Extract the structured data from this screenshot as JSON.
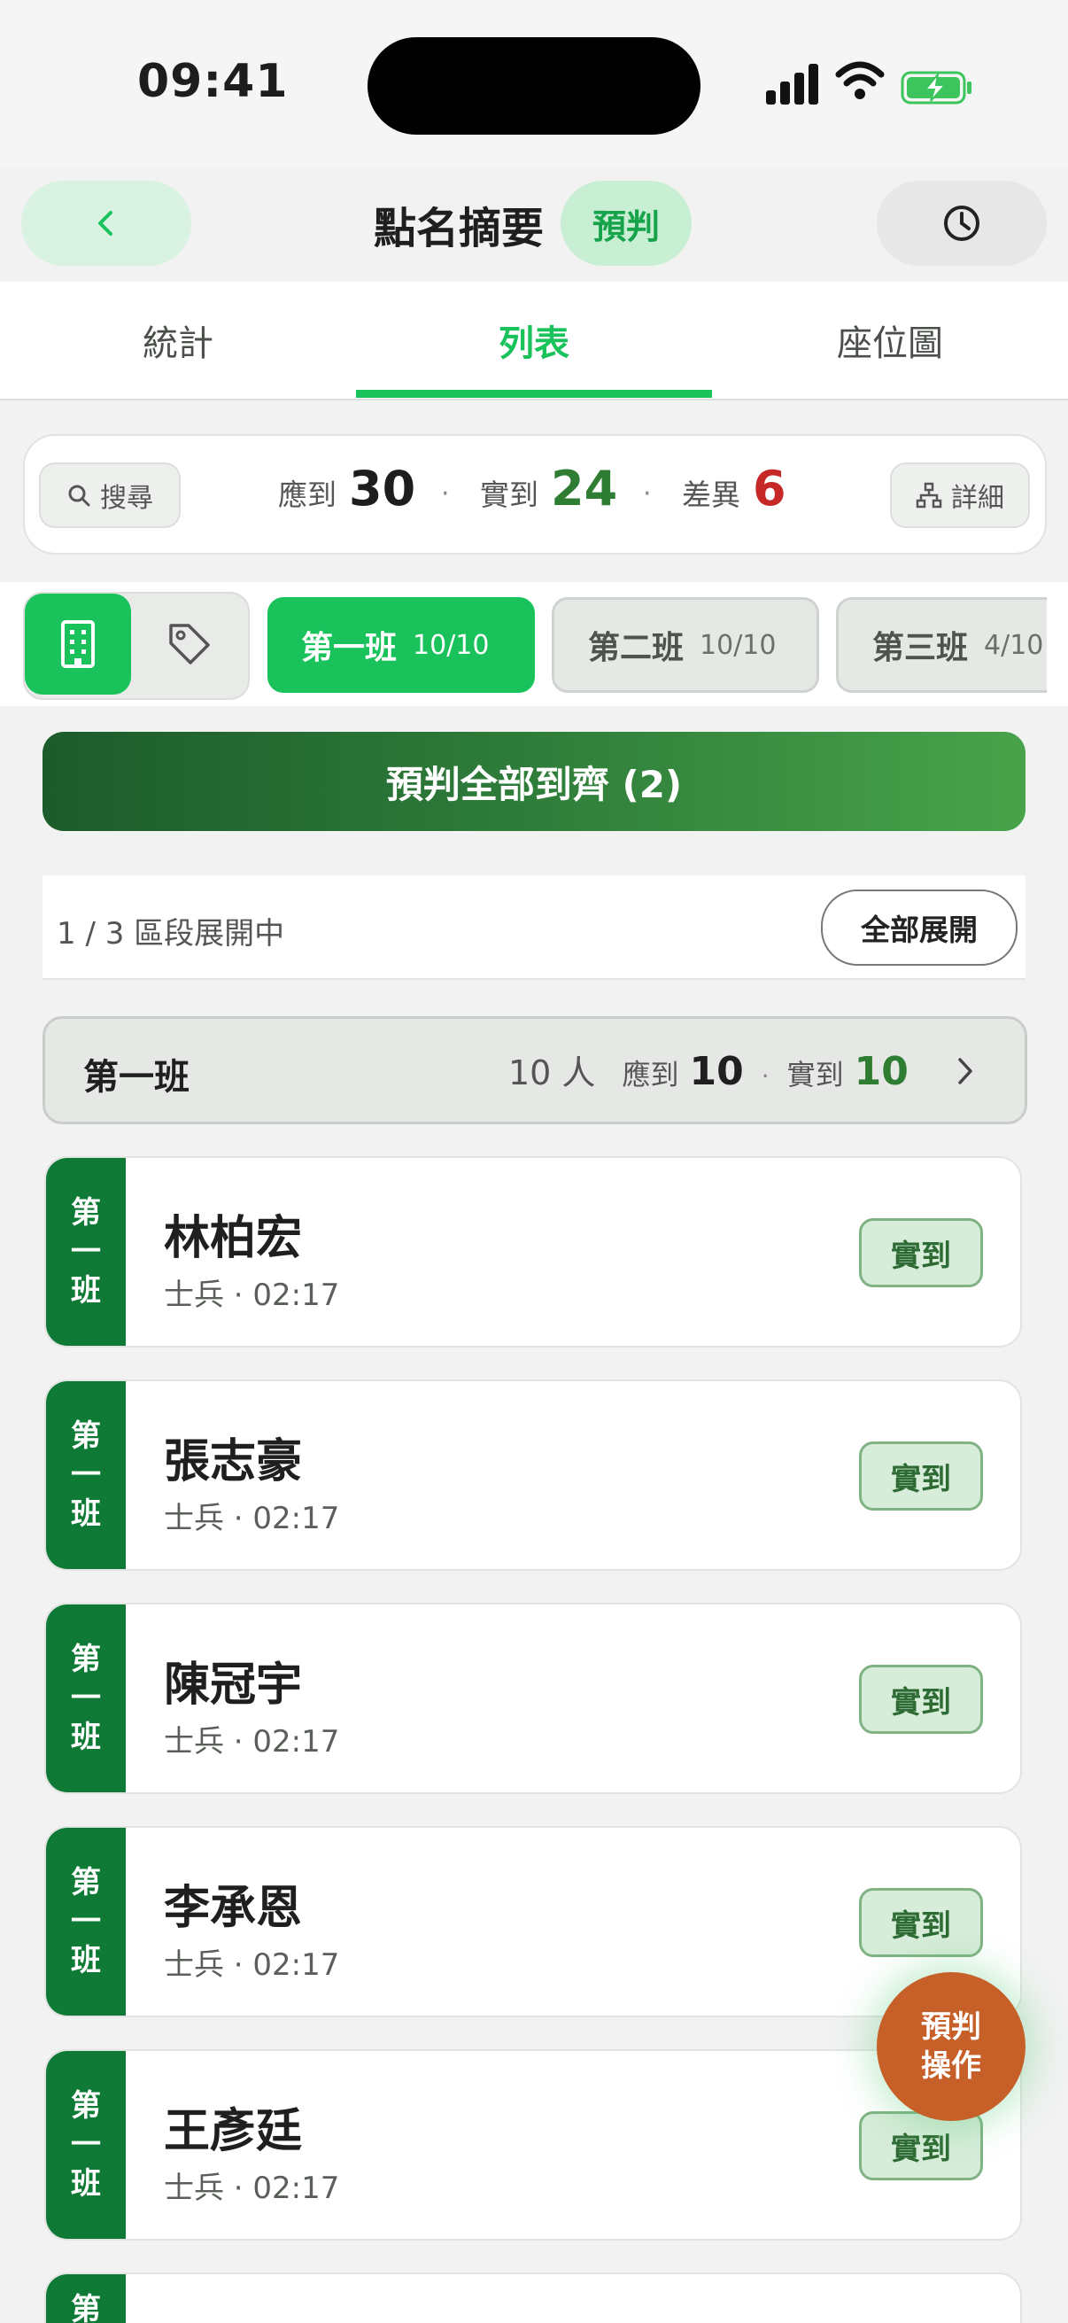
{
  "status_bar": {
    "time": "09:41"
  },
  "header": {
    "title": "點名摘要",
    "badge": "預判"
  },
  "tabs": [
    {
      "label": "統計"
    },
    {
      "label": "列表"
    },
    {
      "label": "座位圖"
    }
  ],
  "summary": {
    "search_label": "搜尋",
    "expected_label": "應到",
    "expected_value": "30",
    "present_label": "實到",
    "present_value": "24",
    "diff_label": "差異",
    "diff_value": "6",
    "separator": "·",
    "detail_label": "詳細",
    "colors": {
      "present": "#2e7d32",
      "diff": "#c62828"
    }
  },
  "filters": {
    "chips": [
      {
        "name": "第一班",
        "count": "10/10"
      },
      {
        "name": "第二班",
        "count": "10/10"
      },
      {
        "name": "第三班",
        "count": "4/10"
      }
    ]
  },
  "predict_all_label": "預判全部到齊 (2)",
  "sections": {
    "text": "1 / 3 區段展開中",
    "expand_all": "全部展開"
  },
  "group": {
    "name": "第一班",
    "people": "10 人",
    "expected_label": "應到",
    "expected_value": "10",
    "present_label": "實到",
    "present_value": "10",
    "separator": "·"
  },
  "students": [
    {
      "tag": [
        "第",
        "一",
        "班"
      ],
      "name": "林柏宏",
      "sub": "士兵 · 02:17",
      "status": "實到"
    },
    {
      "tag": [
        "第",
        "一",
        "班"
      ],
      "name": "張志豪",
      "sub": "士兵 · 02:17",
      "status": "實到"
    },
    {
      "tag": [
        "第",
        "一",
        "班"
      ],
      "name": "陳冠宇",
      "sub": "士兵 · 02:17",
      "status": "實到"
    },
    {
      "tag": [
        "第",
        "一",
        "班"
      ],
      "name": "李承恩",
      "sub": "士兵 · 02:17",
      "status": "實到"
    },
    {
      "tag": [
        "第",
        "一",
        "班"
      ],
      "name": "王彥廷",
      "sub": "士兵 · 02:17",
      "status": "實到"
    },
    {
      "tag": [
        "第",
        "一",
        "班"
      ],
      "name": "",
      "sub": "",
      "status": ""
    }
  ],
  "fab": {
    "line1": "預判",
    "line2": "操作"
  },
  "accent_color": "#19c25a"
}
